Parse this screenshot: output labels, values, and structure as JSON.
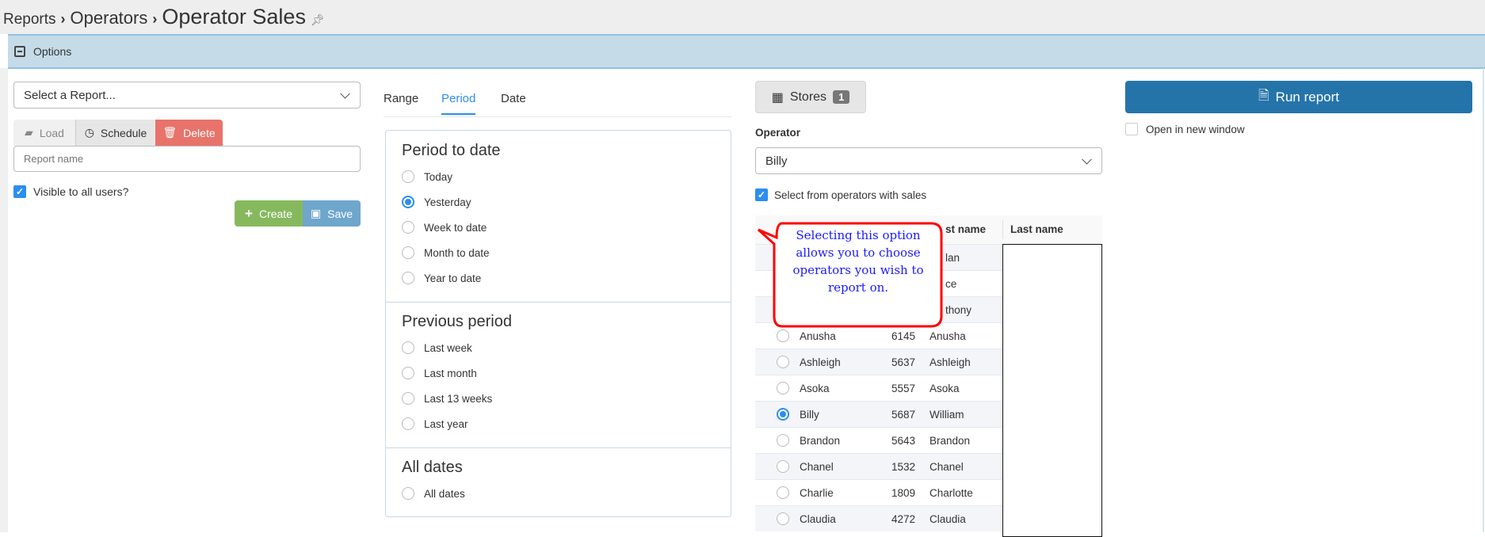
{
  "breadcrumb": {
    "items": [
      "Reports",
      "Operators"
    ],
    "title": "Operator Sales",
    "pin_icon": "pin-icon"
  },
  "options": {
    "label": "Options"
  },
  "left": {
    "report_select": "Select a Report...",
    "load": "Load",
    "schedule": "Schedule",
    "delete": "Delete",
    "report_name_placeholder": "Report name",
    "visible_label": "Visible to all users?",
    "visible_checked": true,
    "create": "Create",
    "save": "Save"
  },
  "tabs": [
    {
      "label": "Range"
    },
    {
      "label": "Period",
      "active": true
    },
    {
      "label": "Date"
    }
  ],
  "period": {
    "sections": [
      {
        "title": "Period to date",
        "options": [
          "Today",
          "Yesterday",
          "Week to date",
          "Month to date",
          "Year to date"
        ]
      },
      {
        "title": "Previous period",
        "options": [
          "Last week",
          "Last month",
          "Last 13 weeks",
          "Last year"
        ]
      },
      {
        "title": "All dates",
        "options": [
          "All dates"
        ]
      }
    ],
    "selected": "Yesterday"
  },
  "stores": {
    "label": "Stores",
    "count": "1"
  },
  "operator": {
    "label": "Operator",
    "value": "Billy",
    "with_sales_label": "Select from operators with sales",
    "with_sales_checked": true,
    "headers": [
      "st name",
      "Last name"
    ],
    "rows": [
      {
        "first": "",
        "code": "",
        "name": "lan",
        "selected": false
      },
      {
        "first": "",
        "code": "",
        "name": "ce",
        "selected": false
      },
      {
        "first": "",
        "code": "",
        "name": "thony",
        "selected": false
      },
      {
        "first": "Anusha",
        "code": "6145",
        "name": "Anusha",
        "selected": false
      },
      {
        "first": "Ashleigh",
        "code": "5637",
        "name": "Ashleigh",
        "selected": false
      },
      {
        "first": "Asoka",
        "code": "5557",
        "name": "Asoka",
        "selected": false
      },
      {
        "first": "Billy",
        "code": "5687",
        "name": "William",
        "selected": true
      },
      {
        "first": "Brandon",
        "code": "5643",
        "name": "Brandon",
        "selected": false
      },
      {
        "first": "Chanel",
        "code": "1532",
        "name": "Chanel",
        "selected": false
      },
      {
        "first": "Charlie",
        "code": "1809",
        "name": "Charlotte",
        "selected": false
      },
      {
        "first": "Claudia",
        "code": "4272",
        "name": "Claudia",
        "selected": false
      }
    ]
  },
  "callout": {
    "text": "Selecting this option allows you to choose operators you wish to report on.",
    "border_color": "#ff0000",
    "text_color": "#1a1aff"
  },
  "run": {
    "label": "Run report",
    "new_window_label": "Open in new window",
    "new_window_checked": false
  },
  "colors": {
    "primary": "#2574a9",
    "danger": "#e8736a",
    "success": "#86b95e",
    "save": "#6fa6cc",
    "accent": "#2b8ef0"
  }
}
